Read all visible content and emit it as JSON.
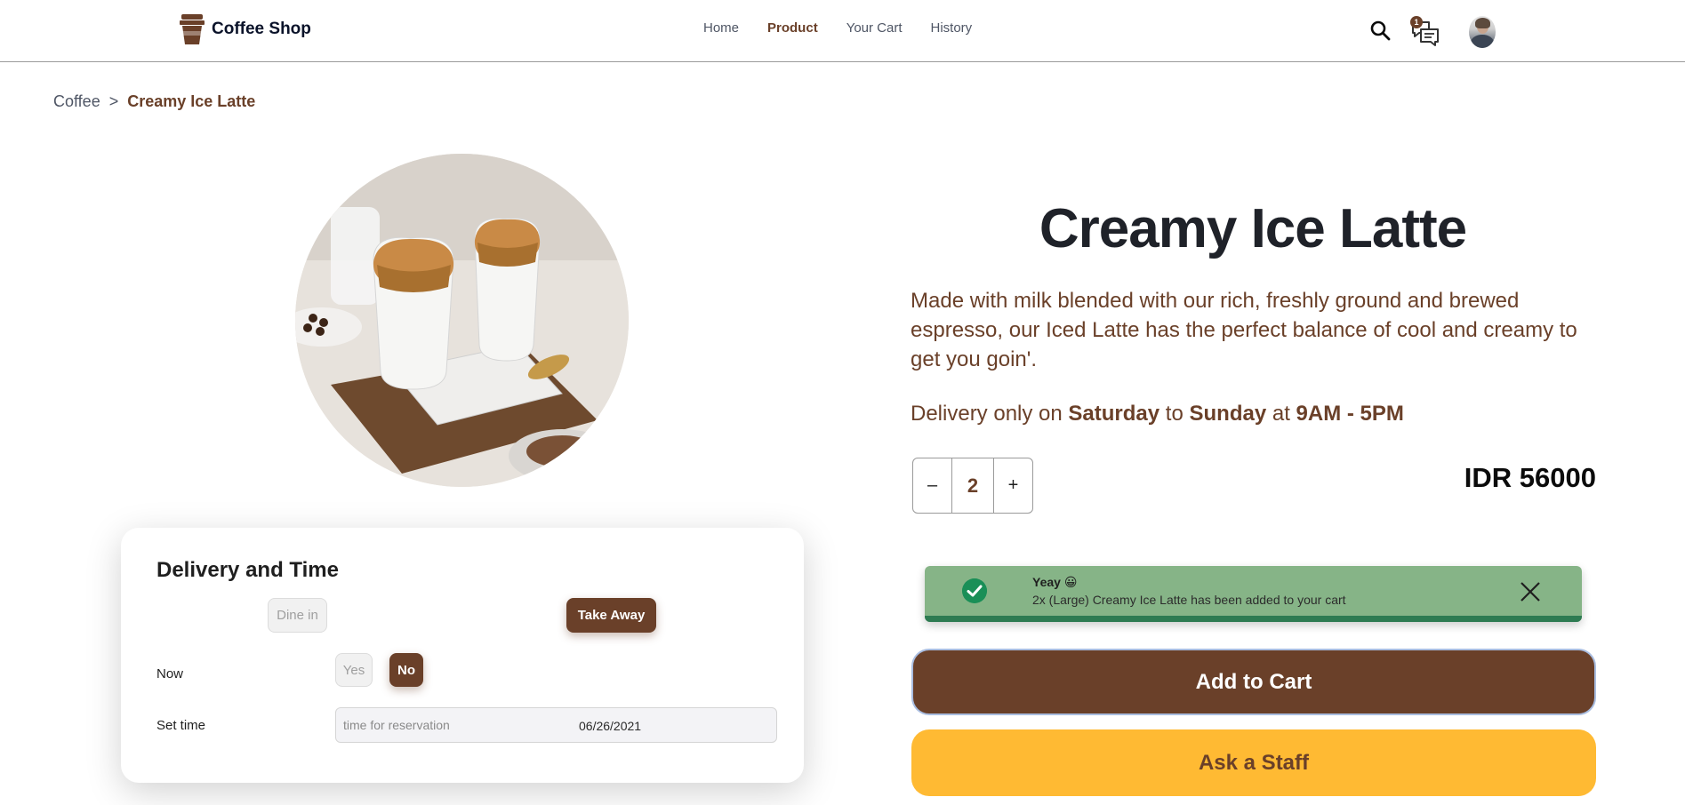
{
  "header": {
    "brand": "Coffee Shop",
    "nav": [
      {
        "label": "Home"
      },
      {
        "label": "Product"
      },
      {
        "label": "Your Cart"
      },
      {
        "label": "History"
      }
    ],
    "active_nav": "Product",
    "chat_badge": "1",
    "icons": [
      "coffee-cup-logo-icon",
      "search-icon",
      "chat-icon",
      "avatar"
    ]
  },
  "breadcrumb": {
    "parent": "Coffee",
    "separator": ">",
    "current": "Creamy Ice Latte"
  },
  "product": {
    "title": "Creamy Ice Latte",
    "description": "Made with milk blended with our rich, freshly ground and brewed espresso, our Iced Latte has the perfect balance of cool and creamy to get you goin'.",
    "delivery_prefix": "Delivery only on",
    "delivery_day_start": "Saturday",
    "delivery_to": "to",
    "delivery_day_end": "Sunday",
    "delivery_at": "at",
    "delivery_hours": "9AM - 5PM",
    "quantity": "2",
    "minus_label": "–",
    "plus_label": "+",
    "price": "IDR 56000"
  },
  "delivery_card": {
    "title": "Delivery and Time",
    "dine_in": "Dine in",
    "take_away": "Take Away",
    "now_label": "Now",
    "yes": "Yes",
    "no": "No",
    "set_time_label": "Set time",
    "time_placeholder": "time for reservation",
    "date_value": "06/26/2021"
  },
  "toast": {
    "title": "Yeay 😀",
    "message": "2x (Large) Creamy Ice Latte has been added to your cart"
  },
  "actions": {
    "add_to_cart": "Add to Cart",
    "ask_staff": "Ask a Staff"
  },
  "colors": {
    "brand_brown": "#6a4029",
    "accent_yellow": "#ffba33",
    "toast_green": "#86b487"
  }
}
